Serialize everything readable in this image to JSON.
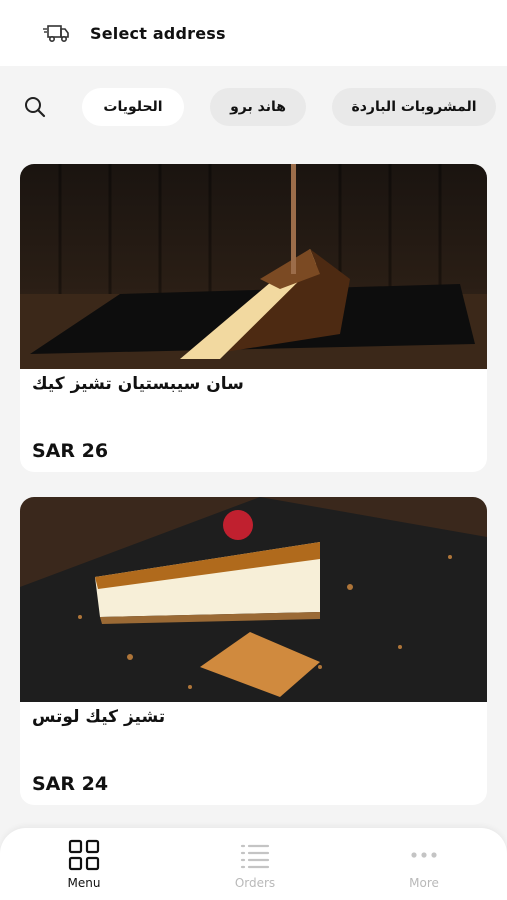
{
  "header": {
    "address_label": "Select address",
    "icon": "delivery-truck-icon"
  },
  "categories": {
    "search_icon": "search-icon",
    "items": [
      {
        "label": "الحلويات",
        "active": true
      },
      {
        "label": "هاند برو",
        "active": false
      },
      {
        "label": "المشروبات الباردة",
        "active": false
      }
    ]
  },
  "products": [
    {
      "name": "سان سيبستيان تشيز كيك",
      "price": "SAR 26"
    },
    {
      "name": "تشيز كيك لوتس",
      "price": "SAR 24"
    }
  ],
  "bottom_nav": {
    "items": [
      {
        "label": "Menu",
        "icon": "grid-icon",
        "active": true
      },
      {
        "label": "Orders",
        "icon": "list-icon",
        "active": false
      },
      {
        "label": "More",
        "icon": "dots-icon",
        "active": false
      }
    ]
  },
  "colors": {
    "background": "#f4f4f4",
    "chip": "#e9e9e9",
    "active_text": "#111111",
    "inactive_text": "#b9b9b9"
  }
}
